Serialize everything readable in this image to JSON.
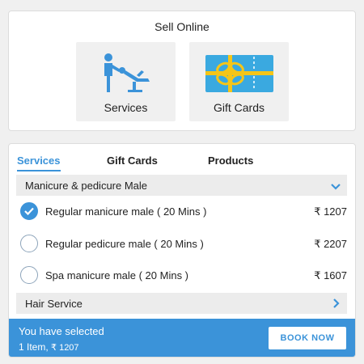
{
  "sell_online": {
    "title": "Sell Online",
    "tiles": [
      {
        "label": "Services",
        "icon": "salon-chair-icon"
      },
      {
        "label": "Gift Cards",
        "icon": "gift-card-icon"
      }
    ]
  },
  "tabs": [
    {
      "label": "Services",
      "active": true
    },
    {
      "label": "Gift Cards",
      "active": false
    },
    {
      "label": "Products",
      "active": false
    }
  ],
  "groups": [
    {
      "label": "Manicure & pedicure Male",
      "icon": "chevron-down-icon",
      "expanded": true,
      "services": [
        {
          "name": "Regular manicure male ( 20 Mins )",
          "price": "₹ 1207",
          "selected": true
        },
        {
          "name": "Regular pedicure male ( 20 Mins )",
          "price": "₹ 2207",
          "selected": false
        },
        {
          "name": "Spa manicure male ( 20 Mins )",
          "price": "₹ 1607",
          "selected": false
        }
      ]
    },
    {
      "label": "Hair Service",
      "icon": "chevron-right-icon",
      "expanded": false
    }
  ],
  "selection_bar": {
    "line1": "You have selected",
    "items_text": "1 Item, ",
    "total": "₹ 1207",
    "book_label": "BOOK NOW"
  },
  "colors": {
    "accent": "#3b93d9",
    "gift_card": "#3aa9e0",
    "gift_ribbon": "#f5c518"
  }
}
